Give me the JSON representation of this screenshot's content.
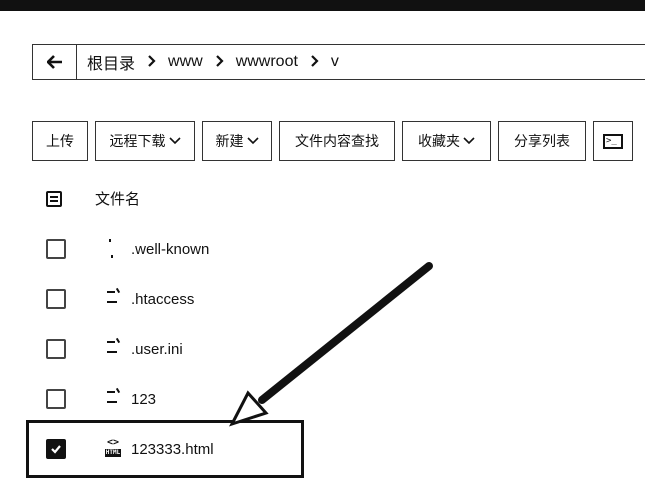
{
  "path_bar": {
    "back_icon": "arrow-left-icon",
    "crumbs": [
      "根目录",
      "www",
      "wwwroot",
      "v"
    ],
    "separator": ">"
  },
  "toolbar": {
    "upload": "上传",
    "remote_download": "远程下载",
    "new": "新建",
    "content_search": "文件内容查找",
    "favorites": "收藏夹",
    "share_list": "分享列表",
    "caret": "⌵",
    "terminal_icon": "terminal-icon"
  },
  "file_list": {
    "header_label": "文件名",
    "files": [
      {
        "name": ".well-known",
        "icon": "folder-icon",
        "checked": false
      },
      {
        "name": ".htaccess",
        "icon": "file-icon",
        "checked": false
      },
      {
        "name": ".user.ini",
        "icon": "file-icon",
        "checked": false
      },
      {
        "name": "123",
        "icon": "file-icon",
        "checked": false
      },
      {
        "name": "123333.html",
        "icon": "html-file-icon",
        "checked": true
      }
    ],
    "html_icon_label": "HTML",
    "html_icon_code": "<>"
  },
  "annotation": {
    "highlight_color": "#111111"
  }
}
